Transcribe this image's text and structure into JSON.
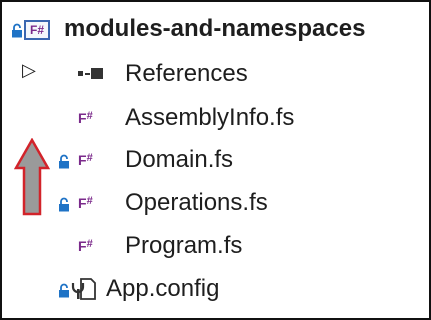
{
  "tree": {
    "project": {
      "label": "modules-and-namespaces",
      "icon": "fsharp-project-icon"
    },
    "items": [
      {
        "label": "References",
        "icon": "references-icon",
        "expander": "▷",
        "locked": false
      },
      {
        "label": "AssemblyInfo.fs",
        "icon": "fsharp-file-icon",
        "locked": false
      },
      {
        "label": "Domain.fs",
        "icon": "fsharp-file-icon",
        "locked": true
      },
      {
        "label": "Operations.fs",
        "icon": "fsharp-file-icon",
        "locked": true
      },
      {
        "label": "Program.fs",
        "icon": "fsharp-file-icon",
        "locked": false
      },
      {
        "label": "App.config",
        "icon": "config-file-icon",
        "locked": true
      }
    ],
    "file_badge": "F",
    "file_badge_hash": "#",
    "project_badge": "F#"
  },
  "colors": {
    "lock": "#1f73c6",
    "fsharp": "#7b2a8b",
    "arrow_fill": "#9a9a9a",
    "arrow_stroke": "#d2232a"
  },
  "annotation": {
    "icon": "up-arrow-annotation"
  }
}
